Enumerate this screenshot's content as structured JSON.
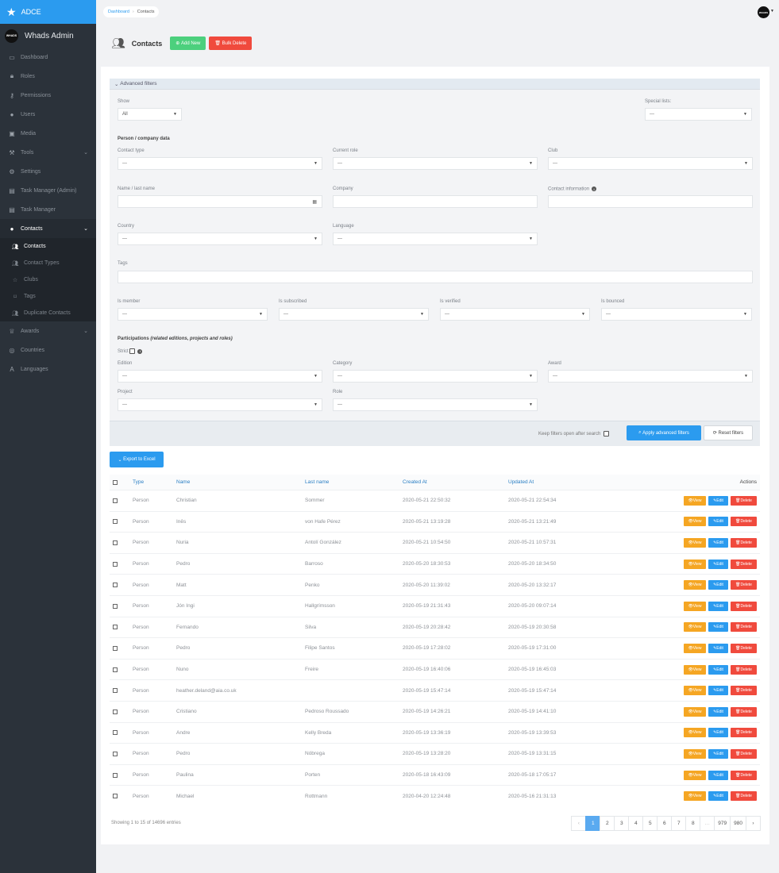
{
  "brand": {
    "name": "ADCE"
  },
  "user": {
    "name": "Whads Admin",
    "logo_text": "WHADS"
  },
  "breadcrumb": {
    "home": "Dashboard",
    "separator": "›",
    "current": "Contacts"
  },
  "avatar": {
    "text": "WHADS"
  },
  "sidebar": {
    "items": [
      {
        "label": "Dashboard",
        "icon": "dashboard-icon"
      },
      {
        "label": "Roles",
        "icon": "lock-icon"
      },
      {
        "label": "Permissions",
        "icon": "key-icon"
      },
      {
        "label": "Users",
        "icon": "user-icon"
      },
      {
        "label": "Media",
        "icon": "image-icon"
      },
      {
        "label": "Tools",
        "icon": "tools-icon"
      },
      {
        "label": "Settings",
        "icon": "gear-icon"
      },
      {
        "label": "Task Manager (Admin)",
        "icon": "task-icon"
      },
      {
        "label": "Task Manager",
        "icon": "task-icon"
      },
      {
        "label": "Contacts",
        "icon": "user-icon"
      }
    ],
    "contacts_sub": [
      {
        "label": "Contacts",
        "icon": "users-icon"
      },
      {
        "label": "Contact Types",
        "icon": "users-icon"
      },
      {
        "label": "Clubs",
        "icon": "star-icon"
      },
      {
        "label": "Tags",
        "icon": "tag-icon"
      },
      {
        "label": "Duplicate Contacts",
        "icon": "users-icon"
      }
    ],
    "items_after": [
      {
        "label": "Awards",
        "icon": "trophy-icon"
      },
      {
        "label": "Countries",
        "icon": "globe-icon"
      },
      {
        "label": "Languages",
        "icon": "language-icon"
      }
    ]
  },
  "header": {
    "title": "Contacts",
    "add_label": "Add New",
    "bulk_delete_label": "Bulk Delete"
  },
  "filters": {
    "title": "Advanced filters",
    "show_label": "Show",
    "show_value": "All",
    "special_lists_label": "Special lists:",
    "placeholder": "---",
    "person_section": "Person / company data",
    "contact_type_label": "Contact type",
    "current_role_label": "Current role",
    "club_label": "Club",
    "name_label": "Name / last name",
    "company_label": "Company",
    "contact_info_label": "Contact information",
    "country_label": "Country",
    "language_label": "Language",
    "tags_label": "Tags",
    "is_member_label": "Is member",
    "is_subscribed_label": "Is subscribed",
    "is_verified_label": "Is verified",
    "is_bounced_label": "Is bounced",
    "participations_label": "Participations",
    "participations_note": "(related editions, projects and roles)",
    "strict_label": "Strict",
    "edition_label": "Edition",
    "category_label": "Category",
    "award_label": "Award",
    "project_label": "Project",
    "role_label": "Role",
    "keep_open_label": "Keep filters open after search",
    "apply_label": "Apply advanced filters",
    "reset_label": "Reset filters"
  },
  "export_label": "Export to Excel",
  "table": {
    "columns": {
      "type": "Type",
      "name": "Name",
      "last_name": "Last name",
      "created": "Created At",
      "updated": "Updated At",
      "actions": "Actions"
    },
    "action_labels": {
      "view": "View",
      "edit": "Edit",
      "delete": "Delete"
    },
    "rows": [
      {
        "type": "Person",
        "name": "Christian",
        "last_name": "Sommer",
        "created": "2020-05-21 22:50:32",
        "updated": "2020-05-21 22:54:34"
      },
      {
        "type": "Person",
        "name": "Inês",
        "last_name": "von Hafe Pérez",
        "created": "2020-05-21 13:19:28",
        "updated": "2020-05-21 13:21:49"
      },
      {
        "type": "Person",
        "name": "Nuria",
        "last_name": "Antolí González",
        "created": "2020-05-21 10:54:50",
        "updated": "2020-05-21 10:57:31"
      },
      {
        "type": "Person",
        "name": "Pedro",
        "last_name": "Barroso",
        "created": "2020-05-20 18:30:53",
        "updated": "2020-05-20 18:34:50"
      },
      {
        "type": "Person",
        "name": "Matt",
        "last_name": "Penko",
        "created": "2020-05-20 11:39:02",
        "updated": "2020-05-20 13:32:17"
      },
      {
        "type": "Person",
        "name": "Jón Ingi",
        "last_name": "Hallgrímsson",
        "created": "2020-05-19 21:31:43",
        "updated": "2020-05-20 09:07:14"
      },
      {
        "type": "Person",
        "name": "Fernando",
        "last_name": "Silva",
        "created": "2020-05-19 20:28:42",
        "updated": "2020-05-19 20:30:58"
      },
      {
        "type": "Person",
        "name": "Pedro",
        "last_name": "Filipe Santos",
        "created": "2020-05-19 17:28:02",
        "updated": "2020-05-19 17:31:00"
      },
      {
        "type": "Person",
        "name": "Nuno",
        "last_name": "Freire",
        "created": "2020-05-19 16:40:06",
        "updated": "2020-05-19 16:45:03"
      },
      {
        "type": "Person",
        "name": "heather.deland@aia.co.uk",
        "last_name": "",
        "created": "2020-05-19 15:47:14",
        "updated": "2020-05-19 15:47:14"
      },
      {
        "type": "Person",
        "name": "Cristiano",
        "last_name": "Pedroso Roussado",
        "created": "2020-05-19 14:26:21",
        "updated": "2020-05-19 14:41:10"
      },
      {
        "type": "Person",
        "name": "Andre",
        "last_name": "Kelly Breda",
        "created": "2020-05-19 13:36:19",
        "updated": "2020-05-19 13:39:53"
      },
      {
        "type": "Person",
        "name": "Pedro",
        "last_name": "Nóbrega",
        "created": "2020-05-19 13:28:20",
        "updated": "2020-05-19 13:31:15"
      },
      {
        "type": "Person",
        "name": "Paulina",
        "last_name": "Porten",
        "created": "2020-05-18 16:43:09",
        "updated": "2020-05-18 17:05:17"
      },
      {
        "type": "Person",
        "name": "Michael",
        "last_name": "Rottmann",
        "created": "2020-04-20 12:24:48",
        "updated": "2020-05-16 21:31:13"
      }
    ]
  },
  "showing_text": "Showing 1 to 15 of 14696 entries",
  "pagination": [
    "‹",
    "1",
    "2",
    "3",
    "4",
    "5",
    "6",
    "7",
    "8",
    "…",
    "979",
    "980",
    "›"
  ],
  "pagination_active": "1"
}
